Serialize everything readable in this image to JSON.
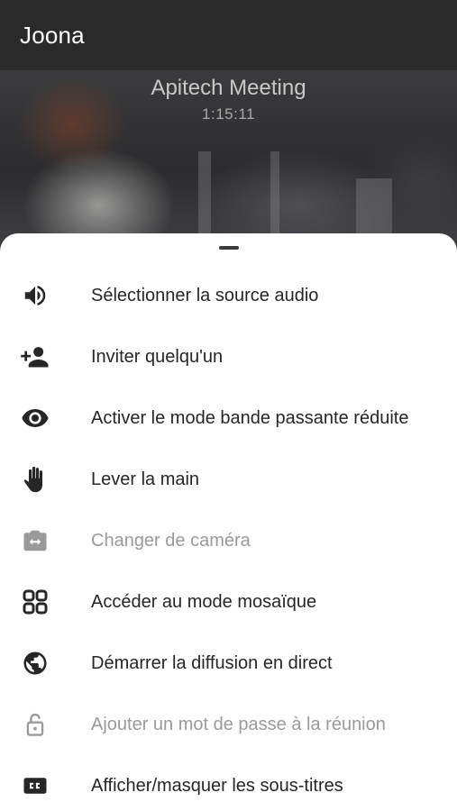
{
  "header": {
    "title": "Joona"
  },
  "meeting": {
    "name": "Apitech Meeting",
    "timer": "1:15:11"
  },
  "menu": {
    "items": [
      {
        "id": "audio",
        "icon": "speaker-icon",
        "label": "Sélectionner la source audio",
        "enabled": true
      },
      {
        "id": "invite",
        "icon": "add-person-icon",
        "label": "Inviter quelqu'un",
        "enabled": true
      },
      {
        "id": "low-bandwidth",
        "icon": "eye-icon",
        "label": "Activer le mode bande passante réduite",
        "enabled": true
      },
      {
        "id": "raise-hand",
        "icon": "hand-icon",
        "label": "Lever la main",
        "enabled": true
      },
      {
        "id": "switch-camera",
        "icon": "camera-switch-icon",
        "label": "Changer de caméra",
        "enabled": false
      },
      {
        "id": "tile-view",
        "icon": "grid-icon",
        "label": "Accéder au mode mosaïque",
        "enabled": true
      },
      {
        "id": "live-stream",
        "icon": "globe-icon",
        "label": "Démarrer la diffusion en direct",
        "enabled": true
      },
      {
        "id": "password",
        "icon": "lock-icon",
        "label": "Ajouter un mot de passe à la réunion",
        "enabled": false
      },
      {
        "id": "subtitles",
        "icon": "closed-captions-icon",
        "label": "Afficher/masquer les sous-titres",
        "enabled": true
      }
    ]
  },
  "colors": {
    "topbar": "#2a2a2a",
    "text": "#262626",
    "disabled": "#9a9a9a",
    "sheet": "#ffffff"
  }
}
